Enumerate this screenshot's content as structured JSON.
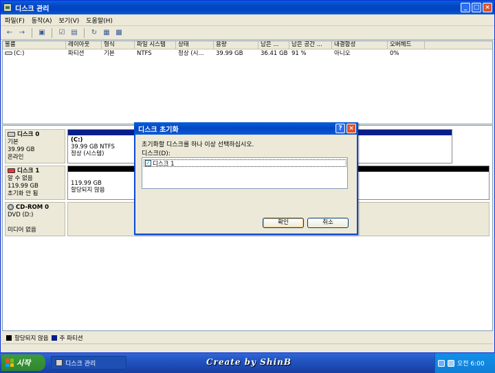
{
  "window": {
    "title": "디스크 관리"
  },
  "menu": [
    "파일(F)",
    "동작(A)",
    "보기(V)",
    "도움말(H)"
  ],
  "volume_table": {
    "columns": [
      "볼륨",
      "레이아웃",
      "형식",
      "파일 시스템",
      "상태",
      "용량",
      "남은 ...",
      "남은 공간 ...",
      "내결함성",
      "오버헤드"
    ],
    "rows": [
      [
        "(C:)",
        "파티션",
        "기본",
        "NTFS",
        "정상 (시...",
        "39.99 GB",
        "36.41 GB",
        "91 %",
        "아니오",
        "0%"
      ]
    ]
  },
  "disks": [
    {
      "name": "디스크 0",
      "type": "기본",
      "size": "39.99 GB",
      "status": "온라인",
      "partition": {
        "name": "(C:)",
        "detail": "39.99 GB NTFS",
        "state": "정상 (시스템)"
      }
    },
    {
      "name": "디스크 1",
      "type": "알 수 없음",
      "size": "119.99 GB",
      "status": "초기화 안 됨",
      "partition": {
        "detail": "119.99 GB",
        "state": "할당되지 않음"
      }
    },
    {
      "name": "CD-ROM 0",
      "type": "DVD (D:)",
      "status": "미디어 없음"
    }
  ],
  "legend": {
    "unallocated": "할당되지 않음",
    "primary": "주 파티션"
  },
  "dialog": {
    "title": "디스크 초기화",
    "message": "초기화할 디스크를 하나 이상 선택하십시오.",
    "list_label": "디스크(D):",
    "items": [
      {
        "label": "디스크 1",
        "checked": true
      }
    ],
    "ok": "확인",
    "cancel": "취소"
  },
  "taskbar": {
    "start": "시작",
    "task": "디스크 관리",
    "watermark": "Create by ShinB",
    "clock": "오전 6:00"
  },
  "colors": {
    "primary_partition": "#0a1e8a",
    "unallocated": "#000000",
    "titlebar": "#0346c4"
  }
}
